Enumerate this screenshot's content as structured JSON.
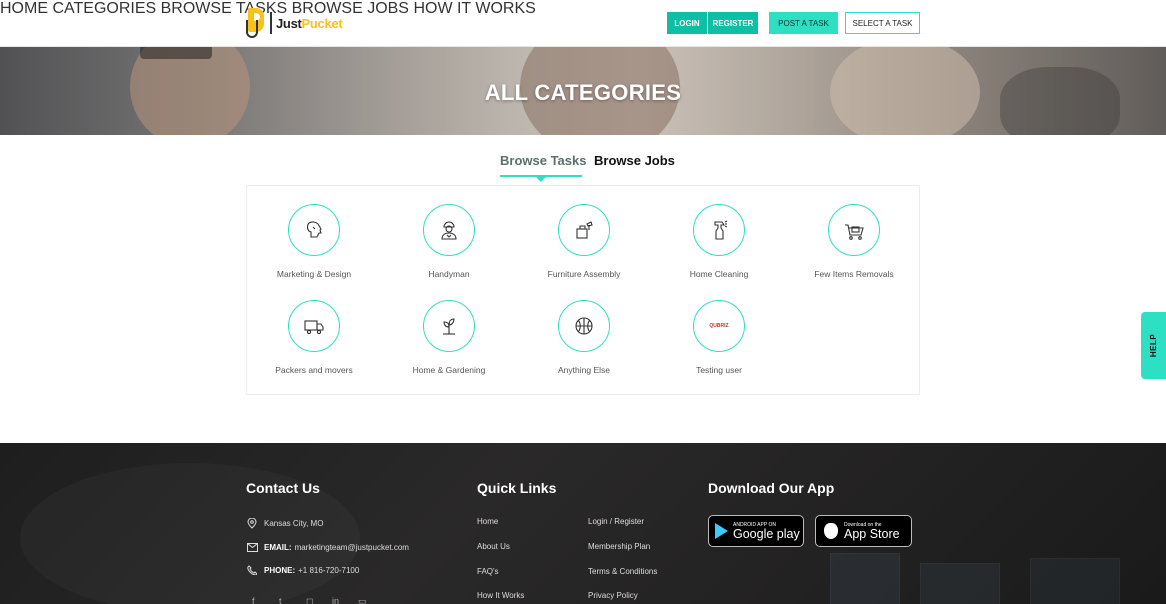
{
  "header": {
    "logo": {
      "brand": "JustPucket",
      "brand_dark": "Just",
      "brand_accent": "Pucket"
    },
    "nav": [
      {
        "label": "HOME"
      },
      {
        "label": "CATEGORIES"
      },
      {
        "label": "BROWSE TASKS"
      },
      {
        "label": "BROWSE JOBS"
      },
      {
        "label": "HOW IT WORKS"
      }
    ],
    "login_label": "LOGIN",
    "register_label": "REGISTER",
    "post_task_label": "POST A TASK",
    "select_task_label": "SELECT A TASK"
  },
  "hero": {
    "title": "ALL CATEGORIES"
  },
  "tabs": [
    {
      "label": "Browse Tasks",
      "active": true
    },
    {
      "label": "Browse Jobs",
      "active": false
    }
  ],
  "categories": [
    {
      "label": "Marketing & Design",
      "icon": "marketing-icon"
    },
    {
      "label": "Handyman",
      "icon": "handyman-icon"
    },
    {
      "label": "Furniture Assembly",
      "icon": "furniture-icon"
    },
    {
      "label": "Home Cleaning",
      "icon": "spray-bottle-icon"
    },
    {
      "label": "Few Items Removals",
      "icon": "cart-icon"
    },
    {
      "label": "Packers and movers",
      "icon": "truck-icon"
    },
    {
      "label": "Home & Gardening",
      "icon": "plant-icon"
    },
    {
      "label": "Anything Else",
      "icon": "basketball-icon"
    },
    {
      "label": "Testing user",
      "icon": "logo-image",
      "logo_text": "QUBRIZ"
    }
  ],
  "help": {
    "label": "HELP"
  },
  "footer": {
    "contact": {
      "title": "Contact Us",
      "location": "Kansas City, MO",
      "email_label": "EMAIL:",
      "email": "marketingteam@justpucket.com",
      "phone_label": "PHONE:",
      "phone": "+1 816-720-7100"
    },
    "quick_links": {
      "title": "Quick Links",
      "col1": [
        "Home",
        "About Us",
        "FAQ's",
        "How It Works"
      ],
      "col2": [
        "Login / Register",
        "Membership Plan",
        "Terms & Conditions",
        "Privacy Policy"
      ]
    },
    "app": {
      "title": "Download Our App",
      "google_small": "ANDROID APP ON",
      "google_big": "Google play",
      "apple_small": "Download on the",
      "apple_big": "App Store"
    }
  },
  "colors": {
    "accent": "#2ee0c3",
    "button": "#0ebfa5",
    "logo_yellow": "#f6c21c",
    "footer_bg": "#232222"
  }
}
